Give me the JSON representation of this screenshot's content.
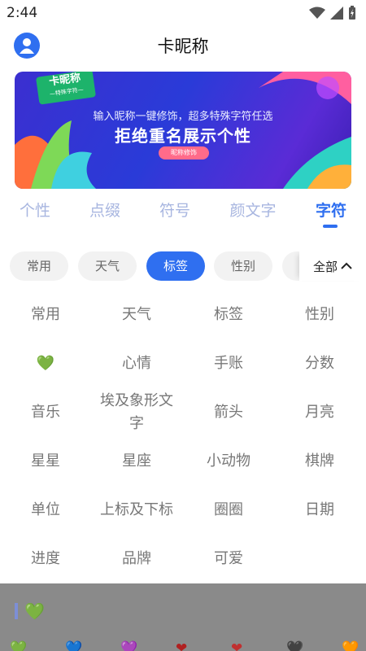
{
  "status_bar": {
    "time": "2:44"
  },
  "header": {
    "title": "卡昵称"
  },
  "banner": {
    "badge_title": "卡昵称",
    "badge_sub": "—特殊字符—",
    "line1": "输入昵称一键修饰，超多特殊字符任选",
    "line2": "拒绝重名展示个性",
    "button": "昵称修饰"
  },
  "tabs": [
    {
      "label": "个性"
    },
    {
      "label": "点缀"
    },
    {
      "label": "符号"
    },
    {
      "label": "颜文字"
    },
    {
      "label": "字符",
      "active": true
    }
  ],
  "chips": [
    {
      "label": "常用"
    },
    {
      "label": "天气"
    },
    {
      "label": "标签",
      "active": true
    },
    {
      "label": "性别"
    },
    {
      "label": ""
    }
  ],
  "all_button": {
    "label": "全部"
  },
  "grid": [
    "常用",
    "天气",
    "标签",
    "性别",
    "💚",
    "心情",
    "手账",
    "分数",
    "音乐",
    "埃及象形文字",
    "箭头",
    "月亮",
    "星星",
    "星座",
    "小动物",
    "棋牌",
    "单位",
    "上标及下标",
    "圈圈",
    "日期",
    "进度",
    "品牌",
    "可爱",
    ""
  ],
  "preview": {
    "heart": "💚"
  },
  "bottom_hearts": [
    "💚",
    "💙",
    "💜",
    "❤",
    "❤",
    "🖤",
    "🧡"
  ],
  "colors": {
    "accent": "#2f6ff0",
    "tab_inactive": "#a8b6e0",
    "chip_bg": "#f2f2f2"
  }
}
